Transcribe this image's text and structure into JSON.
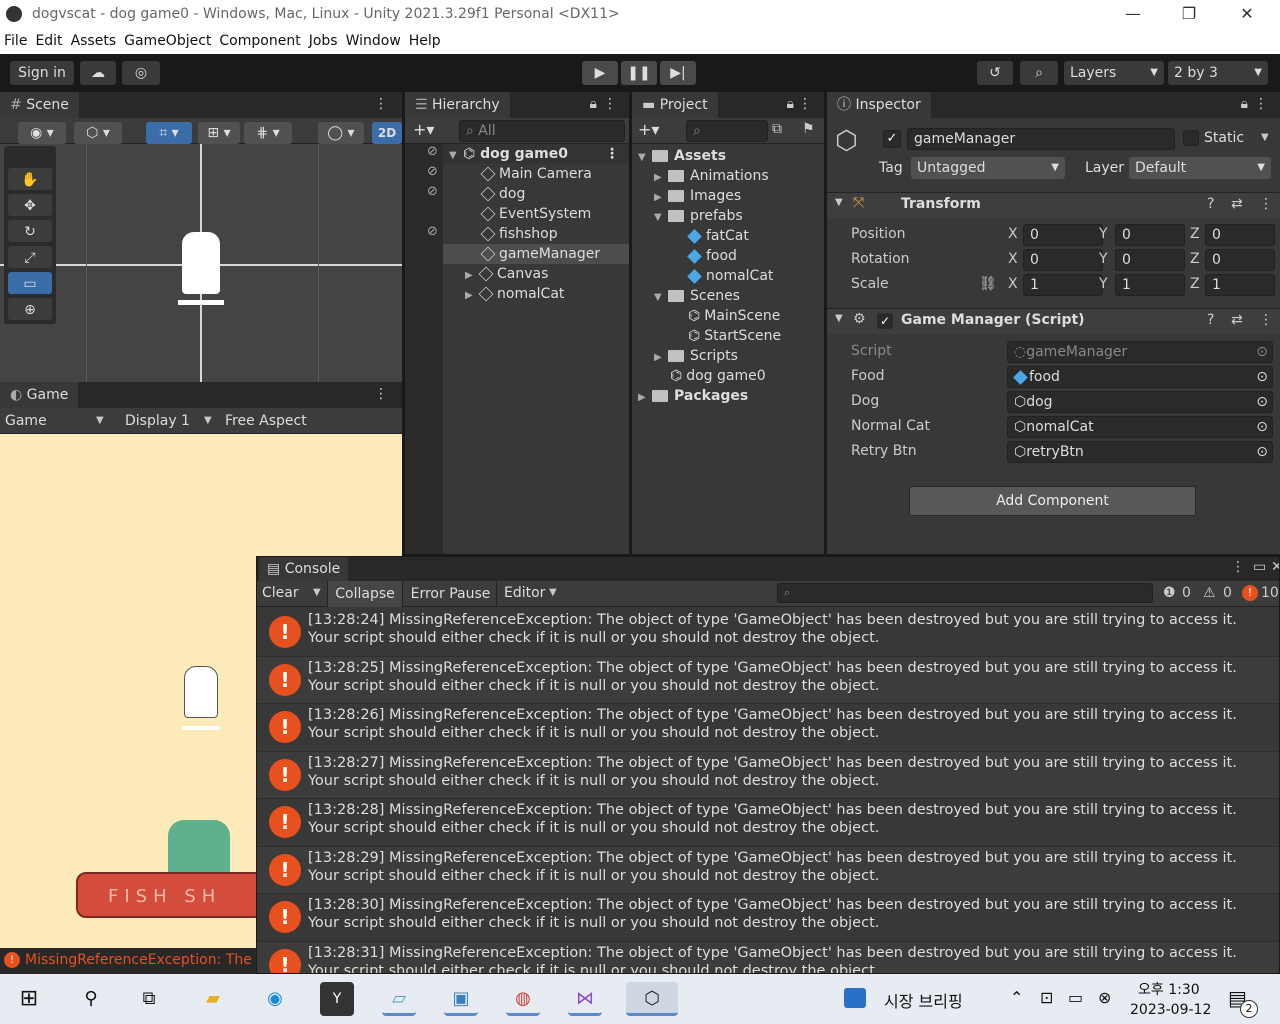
{
  "window": {
    "title": "dogvscat - dog game0 - Windows, Mac, Linux - Unity 2021.3.29f1 Personal <DX11>"
  },
  "menu": [
    "File",
    "Edit",
    "Assets",
    "GameObject",
    "Component",
    "Jobs",
    "Window",
    "Help"
  ],
  "toolbar": {
    "sign_in": "Sign in",
    "layers": "Layers",
    "layout": "2 by 3"
  },
  "scene": {
    "tab": "Scene",
    "mode_2d": "2D"
  },
  "game": {
    "tab": "Game",
    "view": "Game",
    "display": "Display 1",
    "aspect": "Free Aspect"
  },
  "hierarchy": {
    "tab": "Hierarchy",
    "search_placeholder": "All",
    "root": "dog game0",
    "items": [
      "Main Camera",
      "dog",
      "EventSystem",
      "fishshop",
      "gameManager",
      "Canvas",
      "nomalCat"
    ]
  },
  "project": {
    "tab": "Project",
    "assets": "Assets",
    "tree": [
      "Animations",
      "Images",
      "prefabs",
      "fatCat",
      "food",
      "nomalCat",
      "Scenes",
      "MainScene",
      "StartScene",
      "Scripts",
      "dog game0"
    ],
    "packages": "Packages"
  },
  "inspector": {
    "tab": "Inspector",
    "object_name": "gameManager",
    "static": "Static",
    "tag_label": "Tag",
    "tag": "Untagged",
    "layer_label": "Layer",
    "layer": "Default",
    "transform": {
      "title": "Transform",
      "position": {
        "label": "Position",
        "x": "0",
        "y": "0",
        "z": "0"
      },
      "rotation": {
        "label": "Rotation",
        "x": "0",
        "y": "0",
        "z": "0"
      },
      "scale": {
        "label": "Scale",
        "x": "1",
        "y": "1",
        "z": "1"
      }
    },
    "script": {
      "title": "Game Manager (Script)",
      "fields": [
        {
          "label": "Script",
          "value": "gameManager"
        },
        {
          "label": "Food",
          "value": "food"
        },
        {
          "label": "Dog",
          "value": "dog"
        },
        {
          "label": "Normal Cat",
          "value": "nomalCat"
        },
        {
          "label": "Retry Btn",
          "value": "retryBtn"
        }
      ]
    },
    "add_component": "Add Component"
  },
  "console": {
    "tab": "Console",
    "clear": "Clear",
    "collapse": "Collapse",
    "error_pause": "Error Pause",
    "editor": "Editor",
    "info_count": "0",
    "warn_count": "0",
    "error_count": "10",
    "line2": "Your script should either check if it is null or you should not destroy the object.",
    "entries": [
      "[13:28:24] MissingReferenceException: The object of type 'GameObject' has been destroyed but you are still trying to access it.",
      "[13:28:25] MissingReferenceException: The object of type 'GameObject' has been destroyed but you are still trying to access it.",
      "[13:28:26] MissingReferenceException: The object of type 'GameObject' has been destroyed but you are still trying to access it.",
      "[13:28:27] MissingReferenceException: The object of type 'GameObject' has been destroyed but you are still trying to access it.",
      "[13:28:28] MissingReferenceException: The object of type 'GameObject' has been destroyed but you are still trying to access it.",
      "[13:28:29] MissingReferenceException: The object of type 'GameObject' has been destroyed but you are still trying to access it.",
      "[13:28:30] MissingReferenceException: The object of type 'GameObject' has been destroyed but you are still trying to access it.",
      "[13:28:31] MissingReferenceException: The object of type 'GameObject' has been destroyed but you are still trying to access it."
    ]
  },
  "statusbar": {
    "message": "MissingReferenceException: The"
  },
  "game_view": {
    "shop_text": "FISH  SH"
  },
  "taskbar": {
    "news": "시장 브리핑",
    "time": "오후 1:30",
    "date": "2023-09-12",
    "notif_count": "2"
  },
  "colors": {
    "accent": "#4aa8e8",
    "error": "#e8501e",
    "game_bg": "#fcebb8"
  }
}
